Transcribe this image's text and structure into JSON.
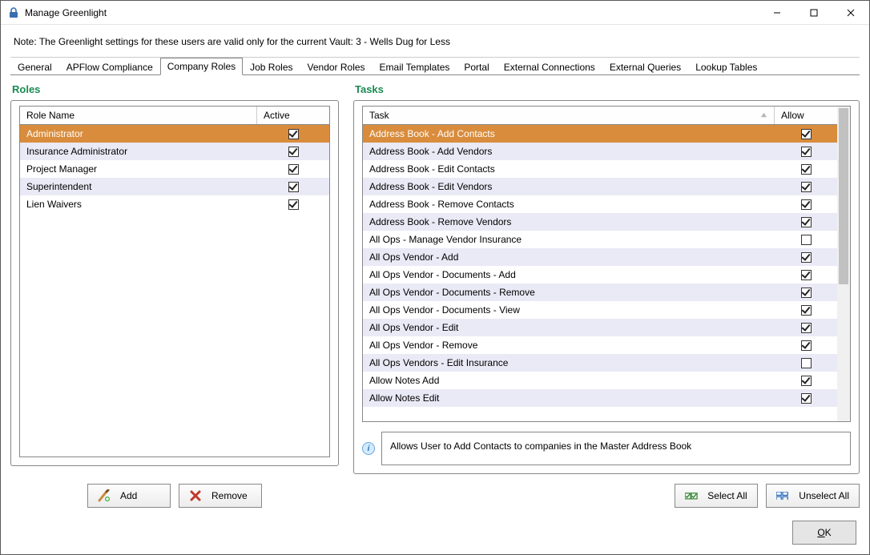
{
  "window": {
    "title": "Manage Greenlight"
  },
  "note": {
    "prefix": "Note:  ",
    "text": "The Greenlight settings for these users are valid only for the current Vault: 3 - Wells Dug for Less"
  },
  "tabs": [
    {
      "label": "General",
      "active": false
    },
    {
      "label": "APFlow Compliance",
      "active": false
    },
    {
      "label": "Company Roles",
      "active": true
    },
    {
      "label": "Job Roles",
      "active": false
    },
    {
      "label": "Vendor Roles",
      "active": false
    },
    {
      "label": "Email Templates",
      "active": false
    },
    {
      "label": "Portal",
      "active": false
    },
    {
      "label": "External Connections",
      "active": false
    },
    {
      "label": "External Queries",
      "active": false
    },
    {
      "label": "Lookup Tables",
      "active": false
    }
  ],
  "roles": {
    "title": "Roles",
    "columns": {
      "name": "Role Name",
      "active": "Active"
    },
    "rows": [
      {
        "name": "Administrator",
        "active": true,
        "selected": true
      },
      {
        "name": "Insurance Administrator",
        "active": true,
        "selected": false
      },
      {
        "name": "Project Manager",
        "active": true,
        "selected": false
      },
      {
        "name": "Superintendent",
        "active": true,
        "selected": false
      },
      {
        "name": "Lien Waivers",
        "active": true,
        "selected": false
      }
    ],
    "buttons": {
      "add": "Add",
      "remove": "Remove"
    }
  },
  "tasks": {
    "title": "Tasks",
    "columns": {
      "task": "Task",
      "allow": "Allow"
    },
    "rows": [
      {
        "task": "Address Book - Add Contacts",
        "allow": true,
        "selected": true
      },
      {
        "task": "Address Book - Add Vendors",
        "allow": true,
        "selected": false
      },
      {
        "task": "Address Book - Edit Contacts",
        "allow": true,
        "selected": false
      },
      {
        "task": "Address Book - Edit Vendors",
        "allow": true,
        "selected": false
      },
      {
        "task": "Address Book - Remove Contacts",
        "allow": true,
        "selected": false
      },
      {
        "task": "Address Book - Remove Vendors",
        "allow": true,
        "selected": false
      },
      {
        "task": "All Ops - Manage Vendor Insurance",
        "allow": false,
        "selected": false
      },
      {
        "task": "All Ops Vendor - Add",
        "allow": true,
        "selected": false
      },
      {
        "task": "All Ops Vendor - Documents - Add",
        "allow": true,
        "selected": false
      },
      {
        "task": "All Ops Vendor - Documents - Remove",
        "allow": true,
        "selected": false
      },
      {
        "task": "All Ops Vendor - Documents - View",
        "allow": true,
        "selected": false
      },
      {
        "task": "All Ops Vendor - Edit",
        "allow": true,
        "selected": false
      },
      {
        "task": "All Ops Vendor - Remove",
        "allow": true,
        "selected": false
      },
      {
        "task": "All Ops Vendors - Edit Insurance",
        "allow": false,
        "selected": false
      },
      {
        "task": "Allow Notes Add",
        "allow": true,
        "selected": false
      },
      {
        "task": "Allow Notes Edit",
        "allow": true,
        "selected": false
      }
    ],
    "info": "Allows User to Add Contacts to companies in the Master Address Book",
    "buttons": {
      "select_all": "Select All",
      "unselect_all": "Unselect All"
    }
  },
  "footer": {
    "ok_letter": "O",
    "ok_rest": "K"
  }
}
